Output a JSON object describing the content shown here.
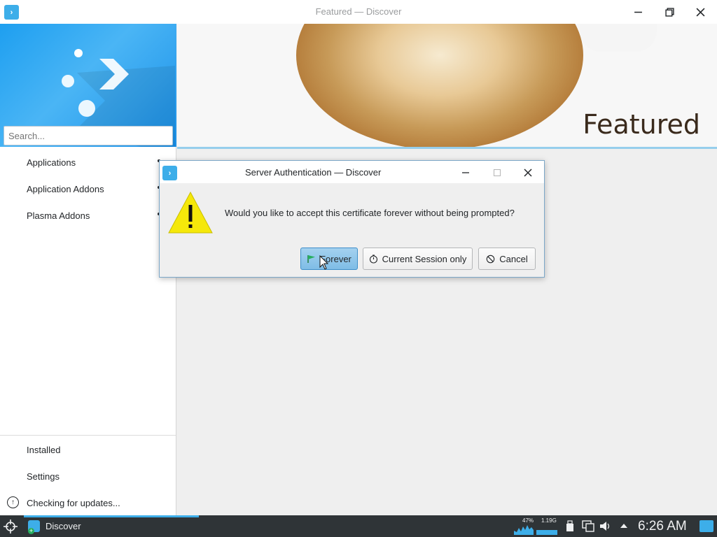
{
  "window": {
    "title": "Featured — Discover"
  },
  "sidebar": {
    "search_placeholder": "Search...",
    "categories": [
      {
        "label": "Applications"
      },
      {
        "label": "Application Addons"
      },
      {
        "label": "Plasma Addons"
      }
    ],
    "bottom": [
      {
        "label": "Installed"
      },
      {
        "label": "Settings"
      },
      {
        "label": "Checking for updates..."
      }
    ]
  },
  "banner": {
    "title": "Featured"
  },
  "dialog": {
    "title": "Server Authentication — Discover",
    "message": "Would you like to accept this certificate forever without being prompted?",
    "buttons": {
      "forever": "Forever",
      "session": "Current Session only",
      "cancel": "Cancel"
    }
  },
  "taskbar": {
    "task_label": "Discover",
    "cpu_label": "47%",
    "mem_label": "1.19G",
    "clock": "6:26 AM"
  },
  "colors": {
    "accent": "#3daee9",
    "taskbar": "#2f3437",
    "primary_button": "#93c9ec"
  }
}
